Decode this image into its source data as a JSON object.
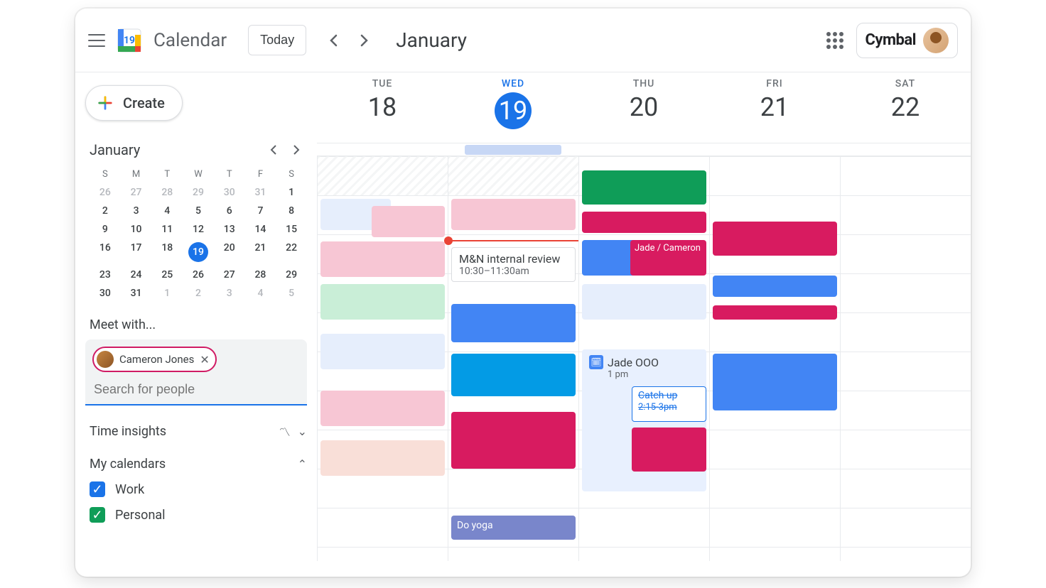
{
  "header": {
    "app_title": "Calendar",
    "today": "Today",
    "month": "January",
    "brand": "Cymbal"
  },
  "sidebar": {
    "create": "Create",
    "mini_month": "January",
    "dow": [
      "S",
      "M",
      "T",
      "W",
      "T",
      "F",
      "S"
    ],
    "weeks": [
      [
        {
          "n": "26",
          "dim": true
        },
        {
          "n": "27",
          "dim": true
        },
        {
          "n": "28",
          "dim": true
        },
        {
          "n": "29",
          "dim": true
        },
        {
          "n": "30",
          "dim": true
        },
        {
          "n": "31",
          "dim": true
        },
        {
          "n": "1"
        }
      ],
      [
        {
          "n": "2"
        },
        {
          "n": "3"
        },
        {
          "n": "4"
        },
        {
          "n": "5"
        },
        {
          "n": "6"
        },
        {
          "n": "7"
        },
        {
          "n": "8"
        }
      ],
      [
        {
          "n": "9"
        },
        {
          "n": "10"
        },
        {
          "n": "11"
        },
        {
          "n": "12"
        },
        {
          "n": "13"
        },
        {
          "n": "14"
        },
        {
          "n": "15"
        }
      ],
      [
        {
          "n": "16"
        },
        {
          "n": "17"
        },
        {
          "n": "18"
        },
        {
          "n": "19",
          "today": true
        },
        {
          "n": "20"
        },
        {
          "n": "21"
        },
        {
          "n": "22"
        }
      ],
      [
        {
          "n": "23"
        },
        {
          "n": "24"
        },
        {
          "n": "25"
        },
        {
          "n": "26"
        },
        {
          "n": "27"
        },
        {
          "n": "28"
        },
        {
          "n": "29"
        }
      ],
      [
        {
          "n": "30"
        },
        {
          "n": "31"
        },
        {
          "n": "1",
          "dim": true
        },
        {
          "n": "2",
          "dim": true
        },
        {
          "n": "3",
          "dim": true
        },
        {
          "n": "4",
          "dim": true
        },
        {
          "n": "5",
          "dim": true
        }
      ]
    ],
    "meet_with": "Meet with...",
    "chip_name": "Cameron Jones",
    "search_placeholder": "Search for people",
    "time_insights": "Time insights",
    "my_calendars": "My calendars",
    "cals": [
      {
        "label": "Work",
        "color": "blue"
      },
      {
        "label": "Personal",
        "color": "green"
      }
    ]
  },
  "days": [
    {
      "dow": "TUE",
      "num": "18"
    },
    {
      "dow": "WED",
      "num": "19",
      "active": true
    },
    {
      "dow": "THU",
      "num": "20"
    },
    {
      "dow": "FRI",
      "num": "21"
    },
    {
      "dow": "SAT",
      "num": "22"
    }
  ],
  "events": {
    "suggest_title": "M&N internal review",
    "suggest_time": "10:30–11:30am",
    "jade_cameron": "Jade / Cameron",
    "jade_ooo": "Jade OOO",
    "jade_ooo_time": "1 pm",
    "catch_up": "Catch up",
    "catch_up_time": "2:15-3pm",
    "do_yoga": "Do yoga"
  }
}
